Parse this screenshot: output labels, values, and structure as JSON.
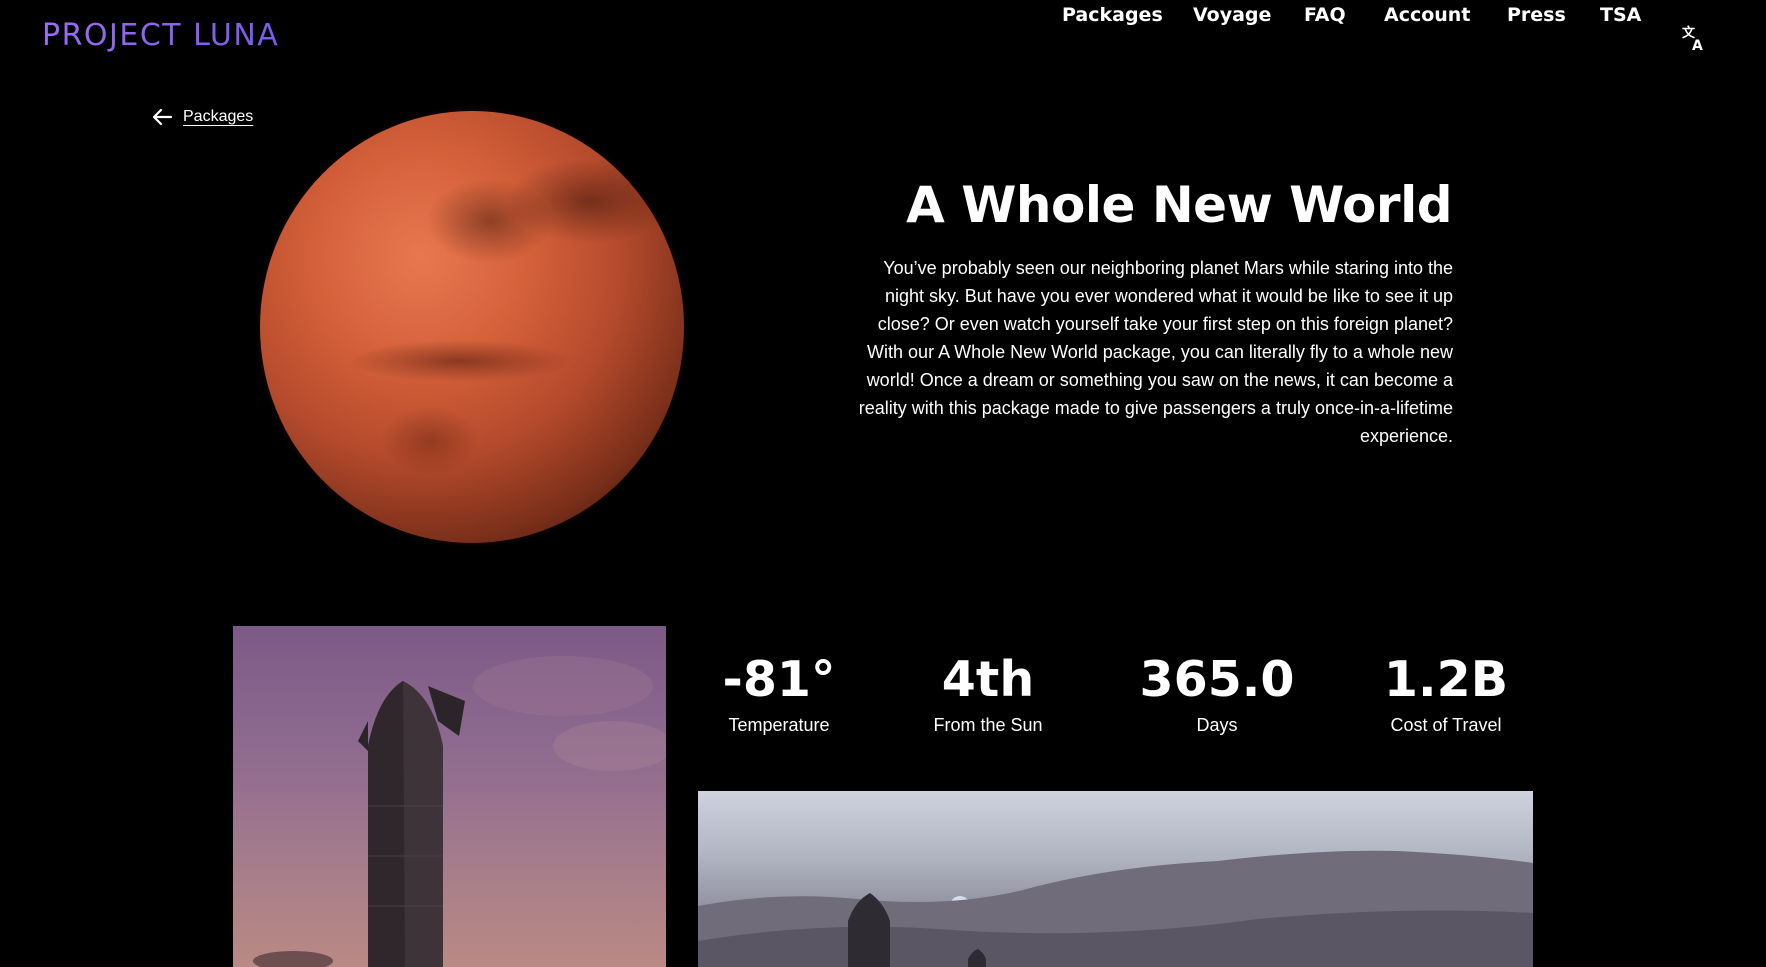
{
  "header": {
    "logo": "PROJECT LUNA",
    "nav": [
      {
        "label": "Packages"
      },
      {
        "label": "Voyage"
      },
      {
        "label": "FAQ"
      },
      {
        "label": "Account"
      },
      {
        "label": "Press"
      },
      {
        "label": "TSA"
      }
    ],
    "translate_icon": "translate-icon"
  },
  "back_link": {
    "label": "Packages",
    "icon": "arrow-left-icon"
  },
  "hero": {
    "title": "A Whole New World",
    "description": "You’ve probably seen our neighboring planet Mars while staring into the night sky. But have you ever wondered what it would be like to see it up close? Or even watch yourself take your first step on this foreign planet? With our A Whole New World package, you can literally fly to a whole new world! Once a dream or something you saw on the news, it can become a reality with this package made to give passengers a truly once-in-a-lifetime experience."
  },
  "stats": [
    {
      "value": "-81°",
      "label": "Temperature"
    },
    {
      "value": "4th",
      "label": "From the Sun"
    },
    {
      "value": "365.0",
      "label": "Days"
    },
    {
      "value": "1.2B",
      "label": "Cost of Travel"
    }
  ],
  "colors": {
    "background": "#000000",
    "text": "#ffffff",
    "logo_gradient_start": "#9a6df0",
    "logo_gradient_end": "#7a5be8",
    "planet": "#c4552f"
  }
}
